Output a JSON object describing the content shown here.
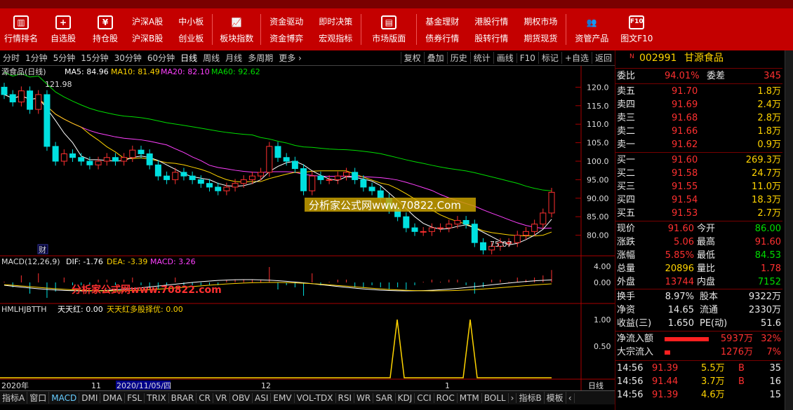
{
  "toolbar": {
    "icons_left": [
      {
        "label": "行情排名",
        "icon": "bar-chart-icon"
      },
      {
        "label": "自选股",
        "icon": "plus-icon"
      },
      {
        "label": "持仓股",
        "icon": "wallet-icon"
      }
    ],
    "grid1": [
      "沪深A股",
      "沪深B股",
      "中小板",
      "创业板"
    ],
    "icon_mid": {
      "label": "板块指数",
      "icon": "trend-icon"
    },
    "grid2": [
      "资金驱动",
      "资金博弈",
      "即时决策",
      "宏观指标"
    ],
    "icon_mid2": {
      "label": "市场版面",
      "icon": "shop-icon"
    },
    "grid3": [
      "基金理财",
      "债券行情",
      "港股行情",
      "股转行情",
      "期权市场",
      "期货现货"
    ],
    "icons_right": [
      {
        "label": "资管产品",
        "icon": "people-icon"
      },
      {
        "label": "图文F10",
        "icon": "f10-icon"
      }
    ]
  },
  "period_tabs": [
    "分时",
    "1分钟",
    "5分钟",
    "15分钟",
    "30分钟",
    "60分钟",
    "日线",
    "周线",
    "月线",
    "多周期",
    "更多 ›"
  ],
  "active_period": "日线",
  "right_tools": [
    "复权",
    "叠加",
    "历史",
    "统计",
    "画线",
    "F10",
    "标记",
    "+自选",
    "返回"
  ],
  "main_chart": {
    "title": "源食品(日线)",
    "ma": [
      {
        "label": "MA5: 84.96",
        "color": "#ffffff"
      },
      {
        "label": "MA10: 81.49",
        "color": "#ffd400"
      },
      {
        "label": "MA20: 82.10",
        "color": "#ff40ff"
      },
      {
        "label": "MA60: 92.62",
        "color": "#00dd00"
      }
    ],
    "high_label": "121.98",
    "low_label": "75.07",
    "cai_label": "财",
    "watermark1": "分析家公式网www.70822.Com",
    "watermark2": "分析家公式网www.70822.com"
  },
  "chart_data": [
    {
      "type": "line",
      "title": "",
      "y_axis": [
        80.0,
        85.0,
        90.0,
        95.0,
        100.0,
        105.0,
        110.0,
        115.0,
        120.0
      ],
      "series": [
        {
          "name": "MA5",
          "values": [
            84.96
          ]
        },
        {
          "name": "MA10",
          "values": [
            81.49
          ]
        },
        {
          "name": "MA20",
          "values": [
            82.1
          ]
        },
        {
          "name": "MA60",
          "values": [
            92.62
          ]
        }
      ],
      "candles_close": [
        118,
        116,
        119,
        114,
        118,
        104,
        100,
        102,
        101,
        100,
        99,
        100,
        101,
        100,
        101,
        103,
        102,
        99,
        96,
        95,
        97,
        96,
        95,
        94,
        93,
        92,
        93,
        94,
        95,
        96,
        97,
        104,
        101,
        100,
        98,
        92,
        96,
        95,
        95,
        96,
        97,
        95,
        93,
        92,
        90,
        87,
        85,
        82,
        81,
        81,
        82,
        82,
        83,
        84,
        83,
        78,
        76,
        77,
        78,
        78,
        80,
        81,
        83,
        86,
        91.6
      ],
      "ylim": [
        75,
        125
      ]
    },
    {
      "type": "line",
      "title": "MACD(12,26,9)",
      "y_axis": [
        0.0,
        4.0
      ],
      "series": [
        {
          "name": "DIF",
          "values": [
            -1.76
          ]
        },
        {
          "name": "DEA",
          "values": [
            -3.39
          ]
        },
        {
          "name": "MACD",
          "values": [
            3.26
          ]
        }
      ]
    },
    {
      "type": "line",
      "title": "HMLHJBTTH",
      "y_axis": [
        0.5,
        1.0
      ],
      "series": [
        {
          "name": "天天红",
          "values": [
            0.0
          ]
        },
        {
          "name": "天天红多股择优",
          "values": [
            0.0
          ]
        }
      ]
    }
  ],
  "macd": {
    "label": "MACD(12,26,9)",
    "dif": "DIF: -1.76",
    "dea": "DEA: -3.39",
    "macd": "MACD: 3.26"
  },
  "ind": {
    "label": "HMLHJBTTH",
    "a": "天天红: 0.00",
    "b": "天天红多股择优: 0.00"
  },
  "time_axis": {
    "a": "2020年",
    "b": "11",
    "c": "2020/11/05/四",
    "d": "12",
    "e": "1",
    "right": "日线"
  },
  "stock": {
    "code": "002991",
    "name": "甘源食品",
    "wb": "94.01%",
    "wc": "345"
  },
  "asks": [
    {
      "l": "卖五",
      "p": "91.70",
      "v": "1.8万"
    },
    {
      "l": "卖四",
      "p": "91.69",
      "v": "2.4万"
    },
    {
      "l": "卖三",
      "p": "91.68",
      "v": "2.8万"
    },
    {
      "l": "卖二",
      "p": "91.66",
      "v": "1.8万"
    },
    {
      "l": "卖一",
      "p": "91.62",
      "v": "0.9万"
    }
  ],
  "bids": [
    {
      "l": "买一",
      "p": "91.60",
      "v": "269.3万"
    },
    {
      "l": "买二",
      "p": "91.58",
      "v": "24.7万"
    },
    {
      "l": "买三",
      "p": "91.55",
      "v": "11.0万"
    },
    {
      "l": "买四",
      "p": "91.54",
      "v": "18.3万"
    },
    {
      "l": "买五",
      "p": "91.53",
      "v": "2.7万"
    }
  ],
  "quote": [
    {
      "l1": "现价",
      "v1": "91.60",
      "l2": "今开",
      "v2": "86.00",
      "c1": "red",
      "c2": "grn"
    },
    {
      "l1": "涨跌",
      "v1": "5.06",
      "l2": "最高",
      "v2": "91.60",
      "c1": "red",
      "c2": "red"
    },
    {
      "l1": "涨幅",
      "v1": "5.85%",
      "l2": "最低",
      "v2": "84.53",
      "c1": "red",
      "c2": "grn"
    },
    {
      "l1": "总量",
      "v1": "20896",
      "l2": "量比",
      "v2": "1.78",
      "c1": "yel",
      "c2": "red"
    },
    {
      "l1": "外盘",
      "v1": "13744",
      "l2": "内盘",
      "v2": "7152",
      "c1": "red",
      "c2": "grn"
    }
  ],
  "quote2": [
    {
      "l1": "换手",
      "v1": "8.97%",
      "l2": "股本",
      "v2": "9322万"
    },
    {
      "l1": "净资",
      "v1": "14.65",
      "l2": "流通",
      "v2": "2330万"
    },
    {
      "l1": "收益(三)",
      "v1": "1.650",
      "l2": "PE(动)",
      "v2": "51.6"
    }
  ],
  "flow": [
    {
      "l": "净流入额",
      "v": "5937万",
      "p": "32%",
      "bar": 0.9
    },
    {
      "l": "大宗流入",
      "v": "1276万",
      "p": "7%",
      "bar": 0.12
    }
  ],
  "ticks": [
    {
      "t": "14:56",
      "p": "91.39",
      "v": "5.5万",
      "s": "B",
      "n": "35"
    },
    {
      "t": "14:56",
      "p": "91.44",
      "v": "3.7万",
      "s": "B",
      "n": "16"
    },
    {
      "t": "14:56",
      "p": "91.39",
      "v": "4.6万",
      "s": "",
      "n": "15"
    }
  ],
  "bottom_tabs": [
    "指标A",
    "窗口",
    "MACD",
    "DMI",
    "DMA",
    "FSL",
    "TRIX",
    "BRAR",
    "CR",
    "VR",
    "OBV",
    "ASI",
    "EMV",
    "VOL-TDX",
    "RSI",
    "WR",
    "SAR",
    "KDJ",
    "CCI",
    "ROC",
    "MTM",
    "BOLL",
    "›",
    "指标B",
    "模板",
    "‹"
  ],
  "active_btab": "MACD"
}
